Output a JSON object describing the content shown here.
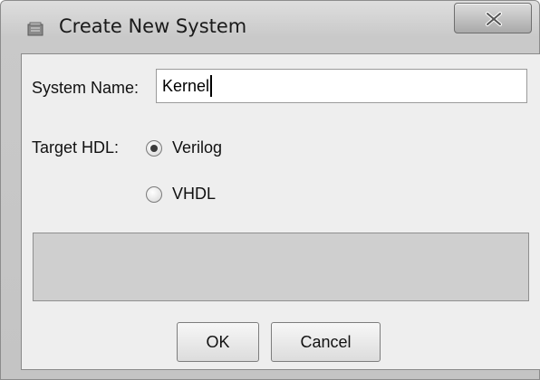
{
  "window": {
    "title": "Create New System",
    "close_glyph": "X"
  },
  "form": {
    "system_name_label": "System Name:",
    "system_name_value": "Kernel",
    "target_hdl_label": "Target HDL:",
    "options": [
      {
        "label": "Verilog",
        "selected": true
      },
      {
        "label": "VHDL",
        "selected": false
      }
    ]
  },
  "buttons": {
    "ok": "OK",
    "cancel": "Cancel"
  }
}
